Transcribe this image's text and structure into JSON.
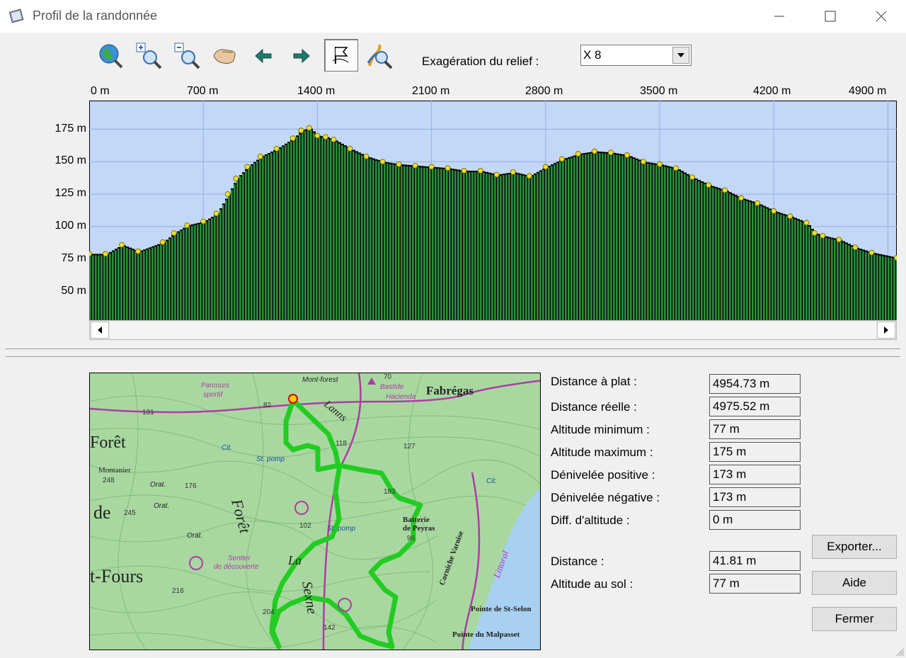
{
  "window": {
    "title": "Profil de la randonnée"
  },
  "toolbar": {
    "tools": [
      "globe-zoom-icon",
      "zoom-in-icon",
      "zoom-out-icon",
      "pan-hand-icon",
      "arrow-left-icon",
      "arrow-right-icon",
      "flag-icon",
      "route-search-icon"
    ],
    "relief_label": "Exagération du relief :",
    "relief_value": "X 8"
  },
  "chart_data": {
    "type": "area",
    "xlabel": "",
    "ylabel": "",
    "x_ticks": [
      "0 m",
      "700 m",
      "1400 m",
      "2100 m",
      "2800 m",
      "3500 m",
      "4200 m",
      "4900 m"
    ],
    "y_ticks": [
      "175 m",
      "150 m",
      "125 m",
      "100 m",
      "75 m",
      "50 m"
    ],
    "xlim": [
      0,
      4954.73
    ],
    "ylim": [
      28,
      197
    ],
    "grid": true,
    "colors": {
      "background": "#c3d7f6",
      "fill": "#2e8b3d",
      "shadow": "#000000",
      "points": "#f2df2a"
    },
    "x": [
      0,
      100,
      200,
      300,
      450,
      520,
      600,
      700,
      780,
      850,
      900,
      970,
      1050,
      1150,
      1250,
      1300,
      1350,
      1400,
      1450,
      1500,
      1600,
      1700,
      1800,
      1900,
      2000,
      2100,
      2200,
      2300,
      2400,
      2500,
      2600,
      2700,
      2800,
      2900,
      3000,
      3100,
      3200,
      3300,
      3400,
      3500,
      3600,
      3700,
      3800,
      3900,
      4000,
      4100,
      4200,
      4300,
      4400,
      4450,
      4500,
      4600,
      4700,
      4800,
      4954
    ],
    "y": [
      79,
      79,
      86,
      81,
      88,
      95,
      101,
      104,
      110,
      125,
      137,
      146,
      154,
      160,
      168,
      174,
      176,
      170,
      169,
      167,
      160,
      154,
      150,
      148,
      147,
      146,
      145,
      143,
      143,
      140,
      142,
      139,
      146,
      152,
      156,
      158,
      157,
      155,
      150,
      148,
      145,
      138,
      132,
      128,
      122,
      118,
      112,
      108,
      103,
      95,
      93,
      90,
      84,
      80,
      76
    ]
  },
  "stats": [
    {
      "label": "Distance à plat :",
      "value": "4954.73 m"
    },
    {
      "label": "Distance réelle :",
      "value": "4975.52 m"
    },
    {
      "label": "Altitude minimum :",
      "value": "77 m"
    },
    {
      "label": "Altitude maximum :",
      "value": "175 m"
    },
    {
      "label": "Dénivelée positive :",
      "value": "173 m"
    },
    {
      "label": "Dénivelée négative :",
      "value": "173 m"
    },
    {
      "label": "Diff. d'altitude :",
      "value": "0 m"
    }
  ],
  "cursor": [
    {
      "label": "Distance :",
      "value": "41.81 m"
    },
    {
      "label": "Altitude au sol :",
      "value": "77 m"
    }
  ],
  "buttons": {
    "export": "Exporter...",
    "help": "Aide",
    "close": "Fermer"
  },
  "map": {
    "labels": {
      "foret": "Forêt",
      "de": "de",
      "fours": "t-Fours",
      "fabregas": "Fabrégas",
      "lanns": "Lanns",
      "montanier": "Montanier",
      "batterie": "Batterie",
      "peyras": "de Peyras",
      "pointe_selon": "Pointe de St-Selon",
      "pointe_malpasset": "Pointe du Malpasset",
      "parcours": "Parcours",
      "sportif": "sportif",
      "corniche": "Corniche Varoise",
      "sentier": "Sentier",
      "decouverte": "de découverte",
      "foret2": "Forêt",
      "mont_forest": "Mont-forest",
      "bastide": "Bastide",
      "hacienda": "Hacienda",
      "st_pomp": "St. pomp",
      "st_pomp2": "St. pomp",
      "orat": "Orat.",
      "orat2": "Orat.",
      "orat3": "Orat.",
      "cit": "Cit.",
      "cit2": "Cit.",
      "la": "La",
      "sexne": "Sexne",
      "littoral": "Littoral"
    },
    "spot_heights": [
      "131",
      "248",
      "245",
      "176",
      "216",
      "204",
      "142",
      "183",
      "127",
      "118",
      "102",
      "96",
      "82",
      "70"
    ],
    "colors": {
      "land": "#a8d8a0",
      "sea": "#a8d0f0",
      "route": "#22cc22",
      "roads": "#b03aa8"
    }
  }
}
